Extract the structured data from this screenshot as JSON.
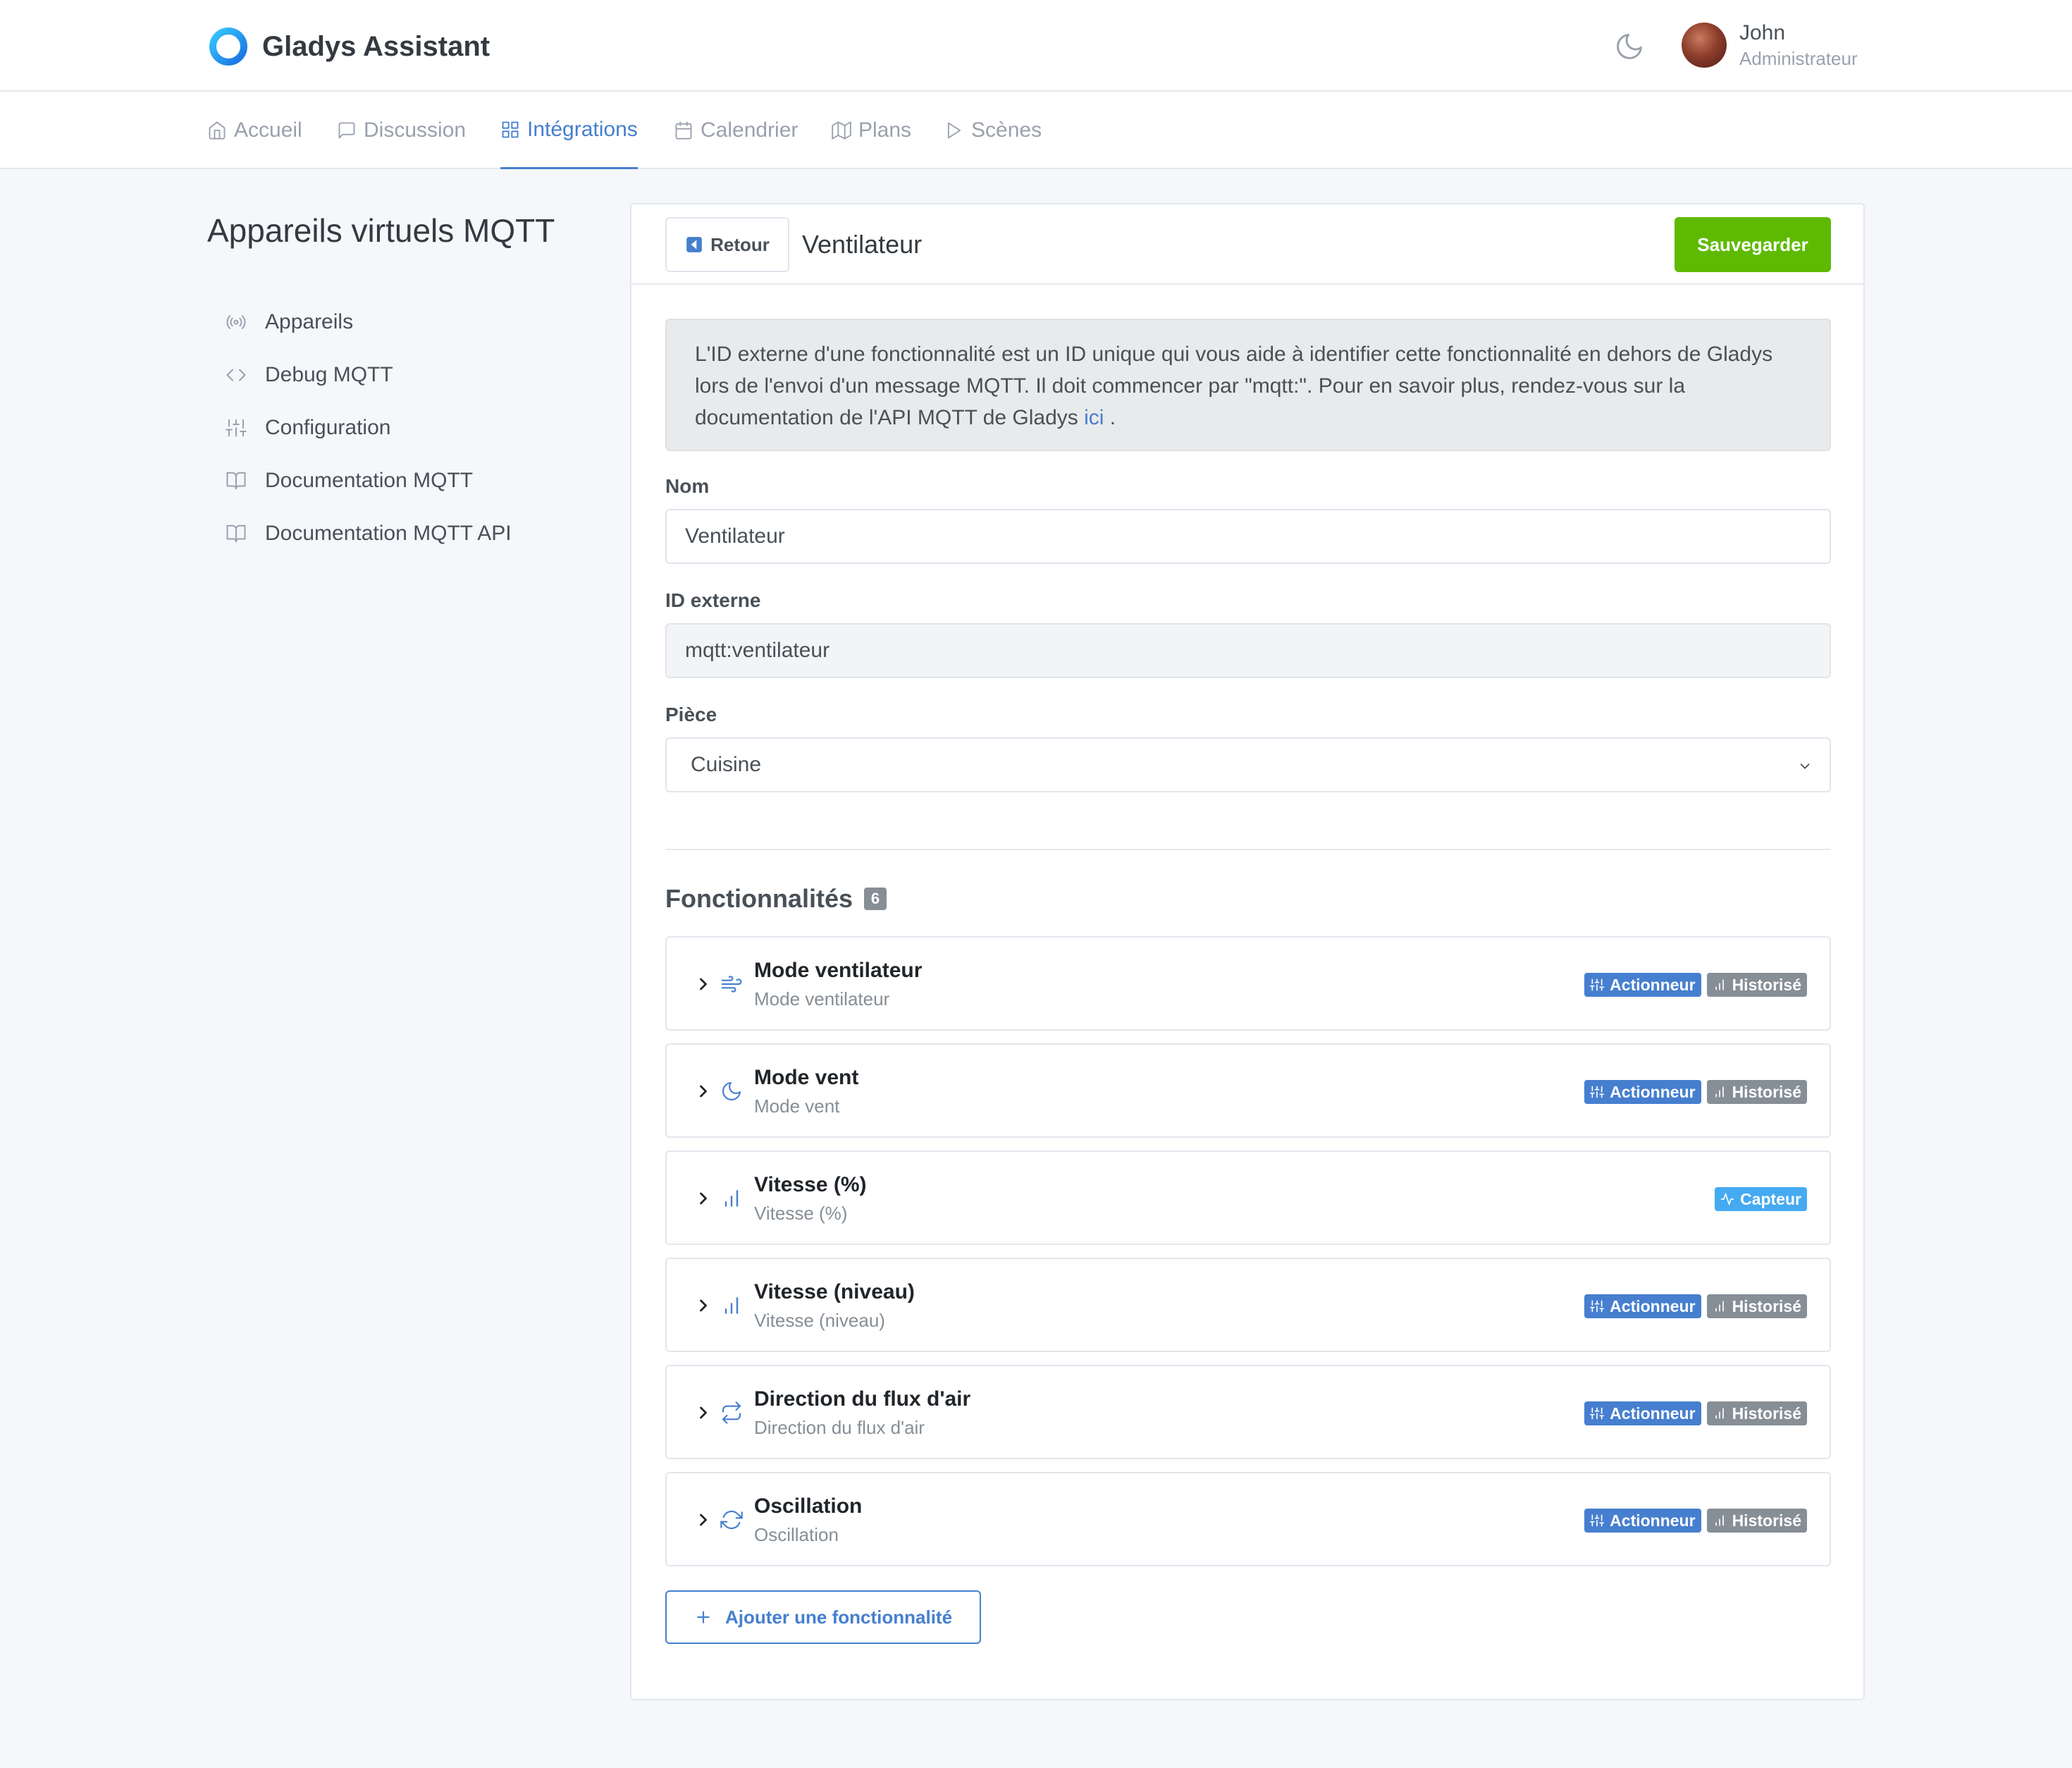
{
  "app": {
    "name": "Gladys Assistant"
  },
  "user": {
    "name": "John",
    "role": "Administrateur"
  },
  "nav": {
    "items": [
      {
        "label": "Accueil",
        "icon": "home-icon"
      },
      {
        "label": "Discussion",
        "icon": "message-square-icon"
      },
      {
        "label": "Intégrations",
        "icon": "grid-icon",
        "active": true
      },
      {
        "label": "Calendrier",
        "icon": "calendar-icon"
      },
      {
        "label": "Plans",
        "icon": "map-icon"
      },
      {
        "label": "Scènes",
        "icon": "play-icon"
      }
    ]
  },
  "sidebar": {
    "title": "Appareils virtuels MQTT",
    "items": [
      {
        "label": "Appareils",
        "icon": "radio-icon"
      },
      {
        "label": "Debug MQTT",
        "icon": "code-icon"
      },
      {
        "label": "Configuration",
        "icon": "sliders-icon"
      },
      {
        "label": "Documentation MQTT",
        "icon": "book-open-icon"
      },
      {
        "label": "Documentation MQTT API",
        "icon": "book-open-icon"
      }
    ]
  },
  "card": {
    "back_label": "Retour",
    "title": "Ventilateur",
    "save_label": "Sauvegarder",
    "info_text": "L'ID externe d'une fonctionnalité est un ID unique qui vous aide à identifier cette fonctionnalité en dehors de Gladys lors de l'envoi d'un message MQTT. Il doit commencer par \"mqtt:\". Pour en savoir plus, rendez-vous sur la documentation de l'API MQTT de Gladys",
    "info_link": "ici",
    "info_end": " .",
    "name_label": "Nom",
    "name_value": "Ventilateur",
    "external_id_label": "ID externe",
    "external_id_value": "mqtt:ventilateur",
    "room_label": "Pièce",
    "room_value": "Cuisine",
    "features_title": "Fonctionnalités",
    "features_count": "6",
    "add_feature_label": "Ajouter une fonctionnalité"
  },
  "badges": {
    "actuator": "Actionneur",
    "historized": "Historisé",
    "sensor": "Capteur"
  },
  "features": [
    {
      "name": "Mode ventilateur",
      "description": "Mode ventilateur",
      "icon": "wind-icon",
      "type": "actuator"
    },
    {
      "name": "Mode vent",
      "description": "Mode vent",
      "icon": "moon-icon",
      "type": "actuator"
    },
    {
      "name": "Vitesse (%)",
      "description": "Vitesse (%)",
      "icon": "bar-chart-icon",
      "type": "sensor"
    },
    {
      "name": "Vitesse (niveau)",
      "description": "Vitesse (niveau)",
      "icon": "bar-chart-icon",
      "type": "actuator"
    },
    {
      "name": "Direction du flux d'air",
      "description": "Direction du flux d'air",
      "icon": "repeat-icon",
      "type": "actuator"
    },
    {
      "name": "Oscillation",
      "description": "Oscillation",
      "icon": "refresh-icon",
      "type": "actuator"
    }
  ],
  "colors": {
    "primary": "#467fcf",
    "success": "#5eba00",
    "secondary": "#868e96",
    "info": "#45aaf2"
  }
}
